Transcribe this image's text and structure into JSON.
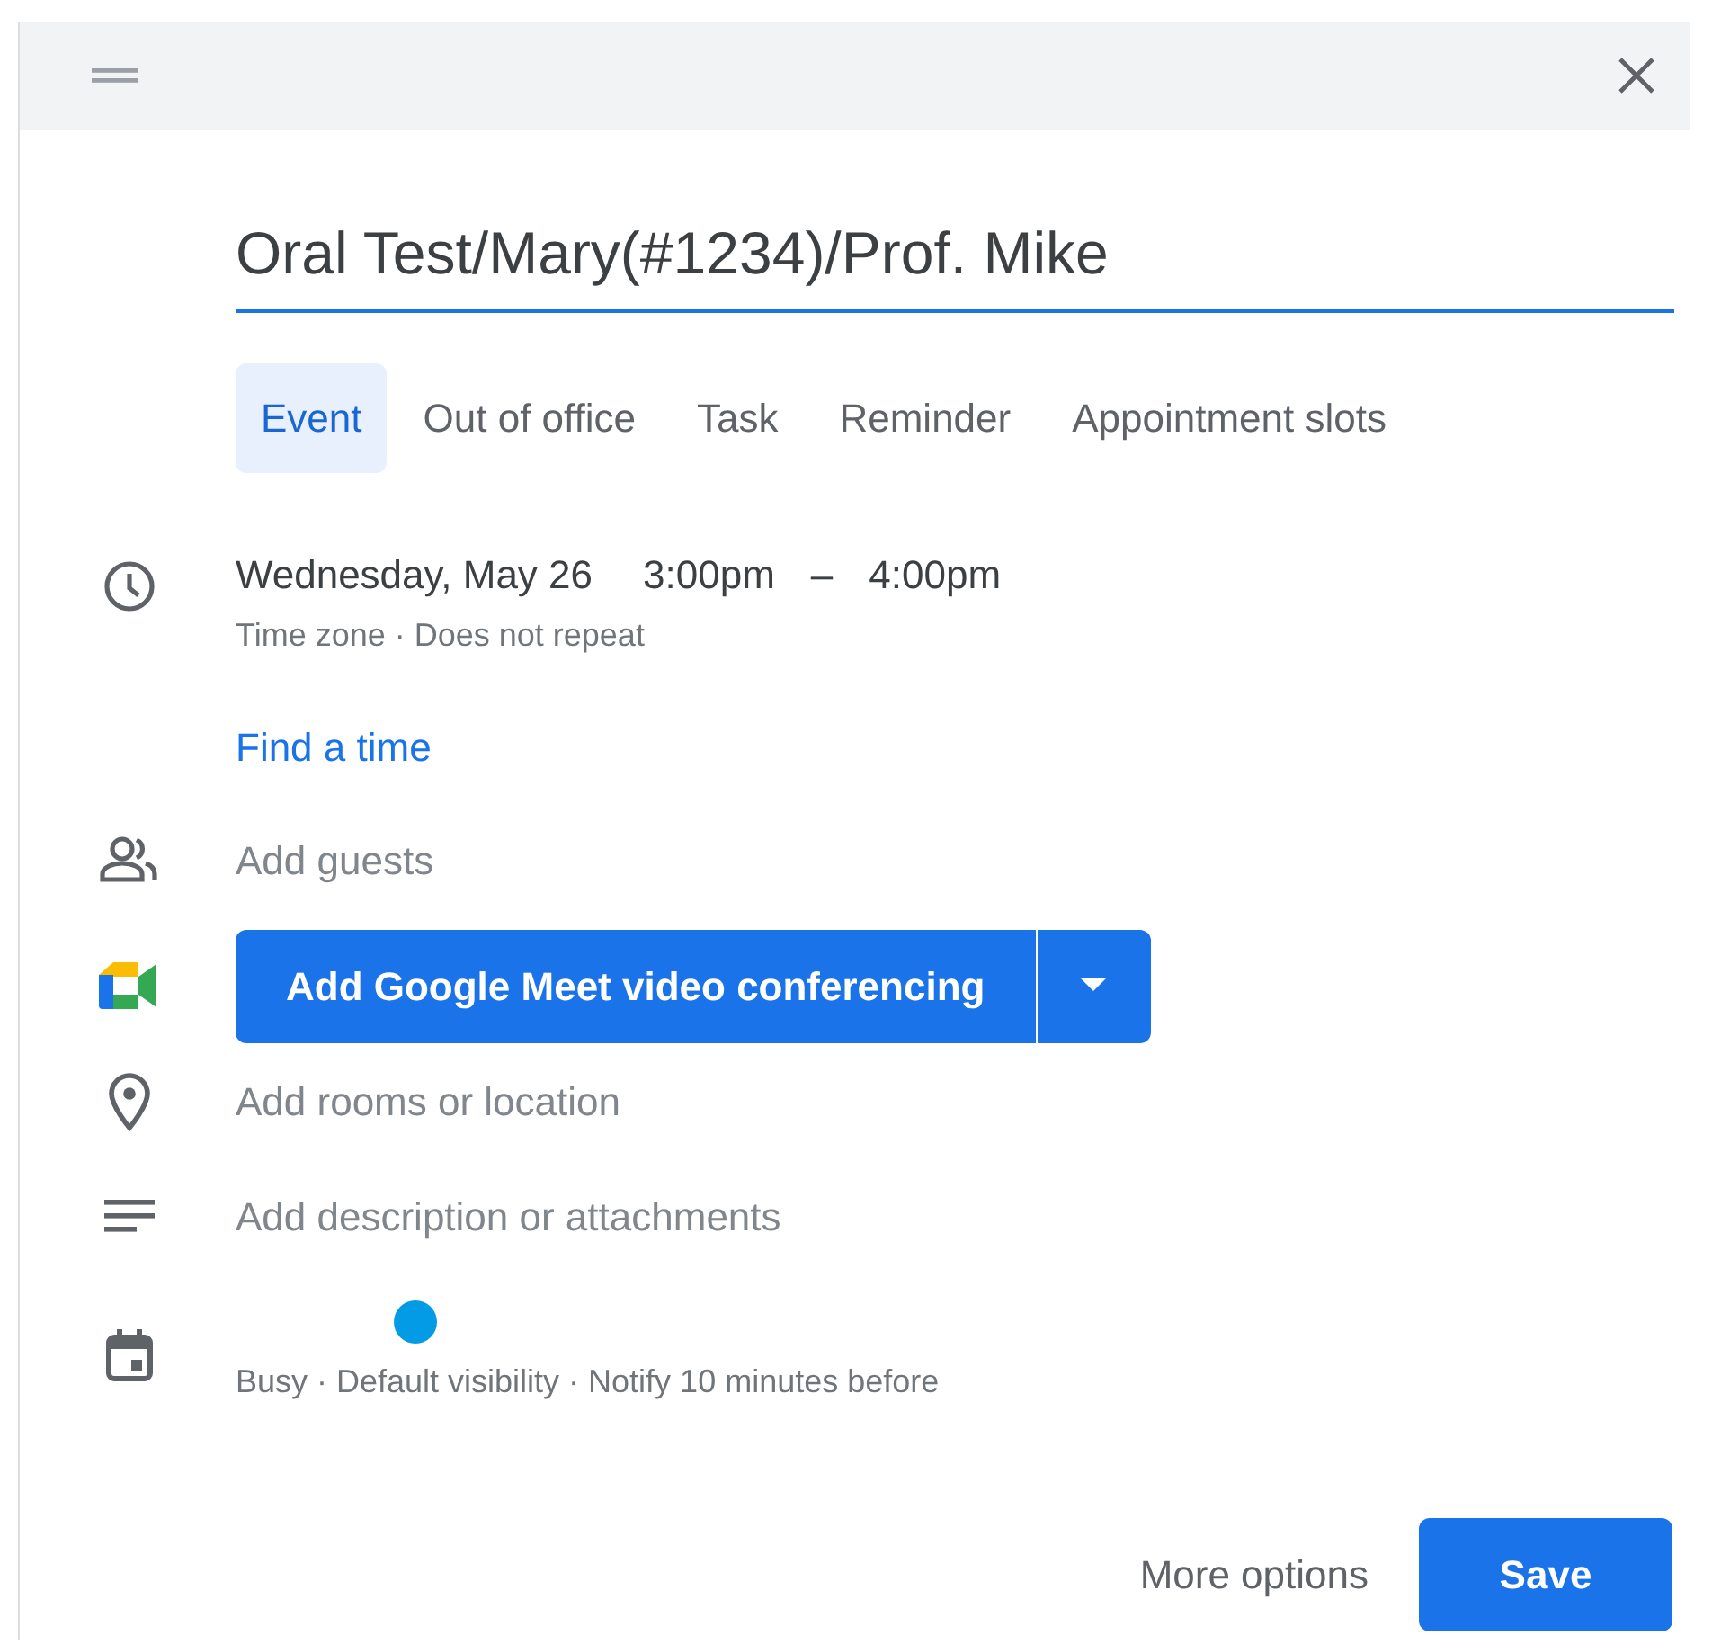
{
  "title_field": {
    "value": "Oral Test/Mary(#1234)/Prof. Mike"
  },
  "tabs": [
    {
      "label": "Event",
      "selected": true
    },
    {
      "label": "Out of office",
      "selected": false
    },
    {
      "label": "Task",
      "selected": false
    },
    {
      "label": "Reminder",
      "selected": false
    },
    {
      "label": "Appointment slots",
      "selected": false
    }
  ],
  "when": {
    "date": "Wednesday, May 26",
    "start": "3:00pm",
    "dash": "–",
    "end": "4:00pm",
    "details": "Time zone · Does not repeat"
  },
  "find_time": "Find a time",
  "guests": {
    "placeholder": "Add guests"
  },
  "meet": {
    "label": "Add Google Meet video conferencing"
  },
  "location": {
    "placeholder": "Add rooms or location"
  },
  "description": {
    "placeholder": "Add description or attachments"
  },
  "calendar": {
    "color": "#039be5",
    "details": "Busy · Default visibility · Notify 10 minutes before"
  },
  "footer": {
    "more": "More options",
    "save": "Save"
  }
}
